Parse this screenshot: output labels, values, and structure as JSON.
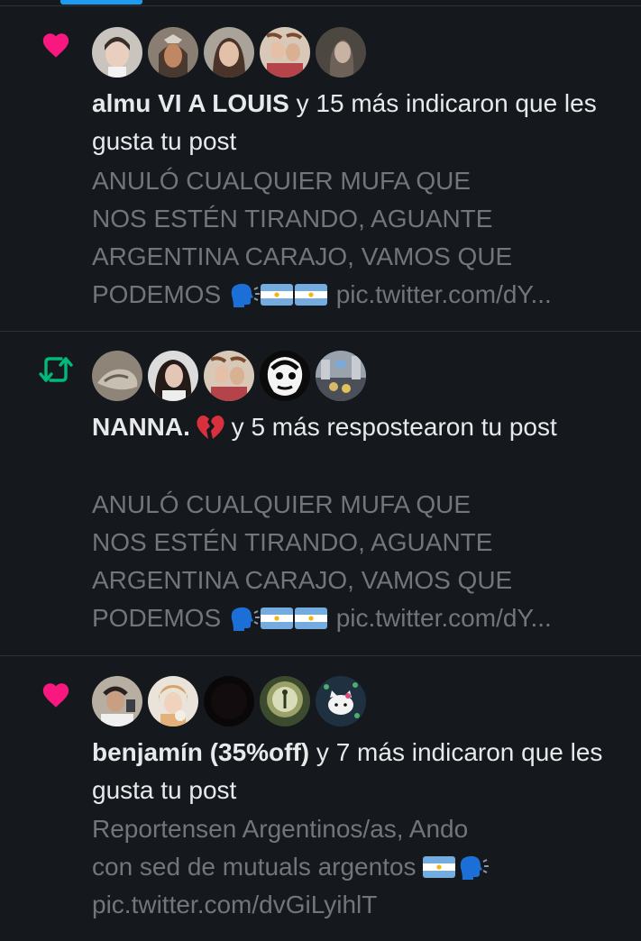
{
  "notifications": [
    {
      "type": "like",
      "icon": "heart-icon",
      "icon_color": "#f91880",
      "actor": "almu VI A LOUIS",
      "action_text": " y 15 más indicaron que les gusta tu post",
      "post_text": {
        "line1": "ANULÓ CUALQUIER MUFA QUE",
        "line2": "NOS ESTÉN TIRANDO, AGUANTE",
        "line3": "ARGENTINA CARAJO, VAMOS QUE",
        "line4_text": "PODEMOS ",
        "line4_link": " pic.twitter.com/dY..."
      }
    },
    {
      "type": "repost",
      "icon": "repost-icon",
      "icon_color": "#00ba7c",
      "actor": "NANNA.",
      "action_text": " y 5 más respostearon tu post",
      "post_text": {
        "line1": "ANULÓ CUALQUIER MUFA QUE",
        "line2": "NOS ESTÉN TIRANDO, AGUANTE",
        "line3": "ARGENTINA CARAJO, VAMOS QUE",
        "line4_text": "PODEMOS ",
        "line4_link": " pic.twitter.com/dY..."
      }
    },
    {
      "type": "like",
      "icon": "heart-icon",
      "icon_color": "#f91880",
      "actor": "benjamín (35%off)",
      "action_text": " y 7 más indicaron que les gusta tu post",
      "post_text": {
        "line1": "Reportensen Argentinos/as, Ando",
        "line2": "con sed de mutuals argentos ",
        "line3": "pic.twitter.com/dvGiLyihlT"
      }
    }
  ],
  "colors": {
    "background": "#15181c",
    "primary_text": "#e7e9ea",
    "secondary_text": "#71767b",
    "divider": "#2f3336",
    "accent": "#1d9bf0"
  }
}
